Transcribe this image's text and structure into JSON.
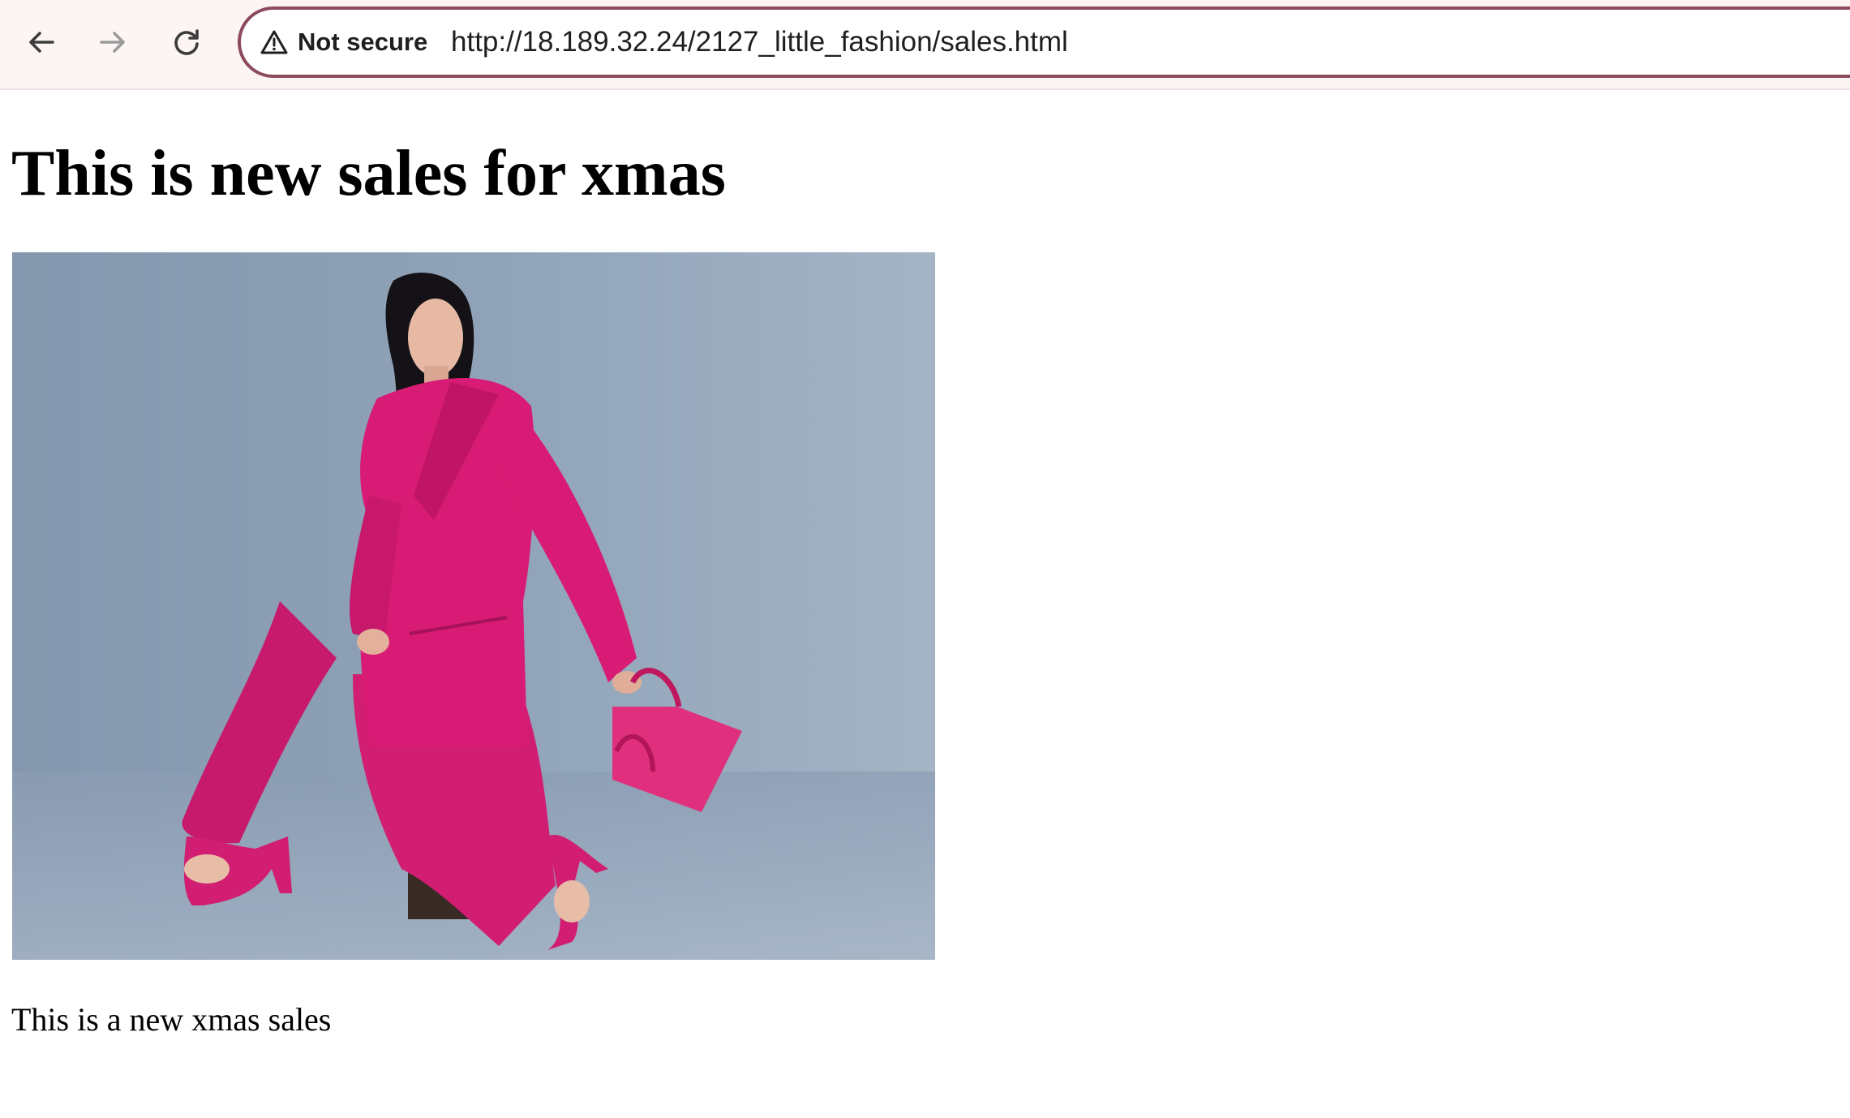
{
  "browser": {
    "security_label": "Not secure",
    "url": "http://18.189.32.24/2127_little_fashion/sales.html",
    "icons": {
      "back": "arrow-left-icon",
      "forward": "arrow-right-icon",
      "reload": "reload-icon",
      "security": "warning-triangle-icon"
    }
  },
  "page": {
    "title": "This is new sales for xmas",
    "description": "This is a new xmas sales"
  },
  "colors": {
    "toolbar_bg": "#fdf5f4",
    "omnibox_border": "#8d4a5e",
    "suit_pink": "#d81b74",
    "photo_bg": "#8fa3ba"
  }
}
